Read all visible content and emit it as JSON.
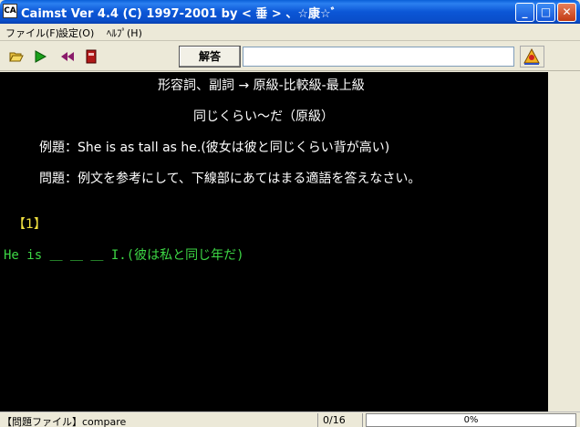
{
  "window": {
    "title": "Caimst Ver 4.4 (C) 1997-2001  by < 垂 > 、☆康☆ﾞ",
    "icon_label": "CA",
    "minimize_glyph": "_",
    "maximize_glyph": "□",
    "close_glyph": "✕"
  },
  "menu": {
    "file": "ファイル(F)",
    "settings": "設定(O)",
    "help": "ﾍﾙﾌﾟ(H)"
  },
  "toolbar": {
    "icons": [
      "open-folder-icon",
      "play-icon",
      "rewind-icon",
      "book-icon",
      "hint-icon"
    ],
    "answer_label": "解答",
    "answer_value": ""
  },
  "content": {
    "heading": "形容詞、副詞 → 原級-比較級-最上級",
    "subheading": "同じくらい～だ（原級）",
    "example": "例題：She is as tall as he.(彼女は彼と同じくらい背が高い)",
    "instruction": "問題：例文を参考にして、下線部にあてはまる適語を答えなさい。",
    "number": "【1】",
    "question": "He is ＿ ＿ ＿ I.(彼は私と同じ年だ)"
  },
  "colors": {
    "background": "#000000",
    "text": "#ffffff",
    "number": "#f0e040",
    "question": "#3dd645"
  },
  "status": {
    "file_label": "【問題ファイル】compare",
    "count": "0/16",
    "progress_text": "0%",
    "progress_fraction": 0
  }
}
